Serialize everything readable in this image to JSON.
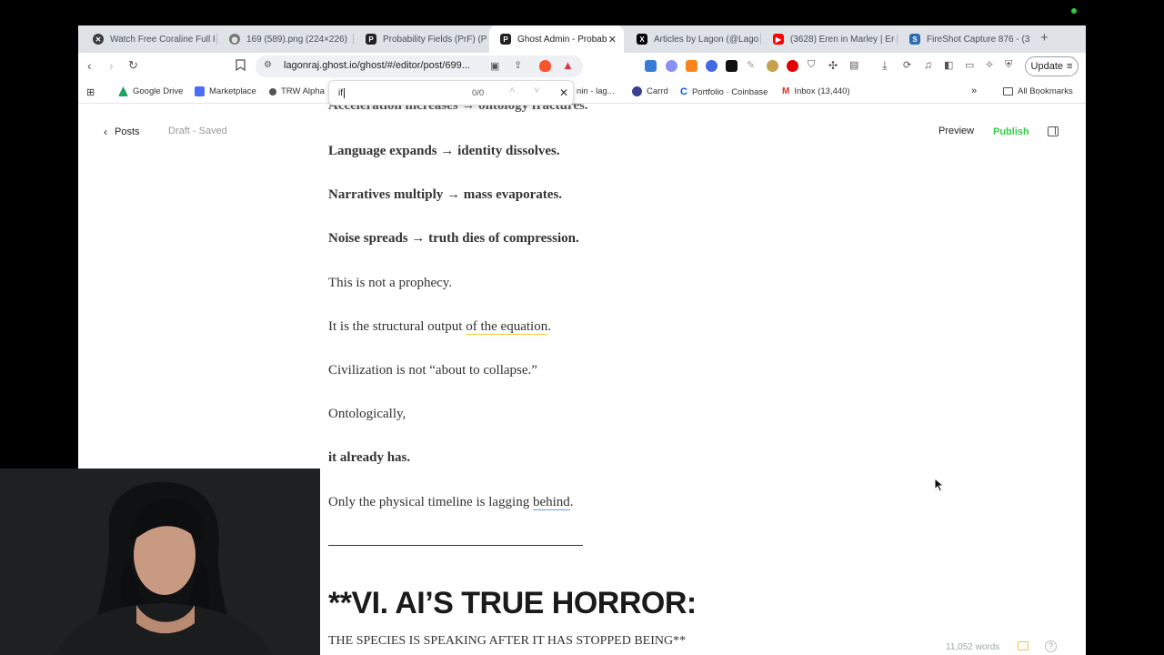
{
  "browser": {
    "tabs": [
      {
        "label": "Watch Free Coraline Full H",
        "favicon": "x-circle-icon",
        "color": "#333333"
      },
      {
        "label": "169 (589).png (224×226)",
        "favicon": "globe-icon",
        "color": "#666666"
      },
      {
        "label": "Probability Fields (PrF) (Pa",
        "favicon": "pdf-icon",
        "color": "#222222"
      },
      {
        "label": "Ghost Admin - Probab",
        "favicon": "pdf-icon",
        "color": "#222222",
        "active": true
      },
      {
        "label": "Articles by Lagon (@Lagor",
        "favicon": "x-logo-icon",
        "color": "#000000"
      },
      {
        "label": "(3628) Eren in Marley | Ere",
        "favicon": "youtube-icon",
        "color": "#ff0000"
      },
      {
        "label": "FireShot Capture 876 - (3",
        "favicon": "fireshot-icon",
        "color": "#2b6cb0"
      }
    ],
    "url": "lagonraj.ghost.io/ghost/#/editor/post/699...",
    "update_label": "Update",
    "bookmarks": [
      {
        "label": "Google Drive",
        "icon": "google-drive-icon",
        "color": "#1fa463"
      },
      {
        "label": "Marketplace",
        "icon": "marketplace-icon",
        "color": "#4a6cf7"
      },
      {
        "label": "TRW Alpha",
        "icon": "trw-icon",
        "color": "#555555"
      },
      {
        "label": "nin - lag...",
        "icon": "bookmark-icon",
        "color": "#888888"
      },
      {
        "label": "Carrd",
        "icon": "carrd-icon",
        "color": "#3b3f8f"
      },
      {
        "label": "Portfolio · Coinbase",
        "icon": "coinbase-icon",
        "color": "#0052ff"
      },
      {
        "label": "Inbox (13,440)",
        "icon": "gmail-icon",
        "color": "#d93025"
      }
    ],
    "all_bookmarks_label": "All Bookmarks",
    "find": {
      "query": "if",
      "count": "0/0"
    }
  },
  "editor": {
    "back_label": "Posts",
    "status": "Draft - Saved",
    "preview_label": "Preview",
    "publish_label": "Publish",
    "word_count": "11,052 words",
    "top_partial": "Acceleration increases → ontology fractures.",
    "p1": "Language expands → identity dissolves.",
    "p2": "Narratives multiply → mass evaporates.",
    "p3": "Noise spreads → truth dies of compression.",
    "p4": "This is not a prophecy.",
    "p5_a": "It is the structural output ",
    "p5_b": "of the equation",
    "p5_c": ".",
    "p6": "Civilization is not “about to collapse.”",
    "p7": "Ontologically,",
    "p8": "it already has.",
    "p9_a": "Only the physical timeline is lagging ",
    "p9_b": "behind",
    "p9_c": ".",
    "heading": "**VI. AI’S TRUE HORROR:",
    "subheading": "THE SPECIES IS SPEAKING AFTER IT HAS STOPPED BEING**"
  },
  "colors": {
    "publish": "#30cf43",
    "underline_yellow": "#f6c945",
    "underline_blue": "#6b9fe0"
  }
}
